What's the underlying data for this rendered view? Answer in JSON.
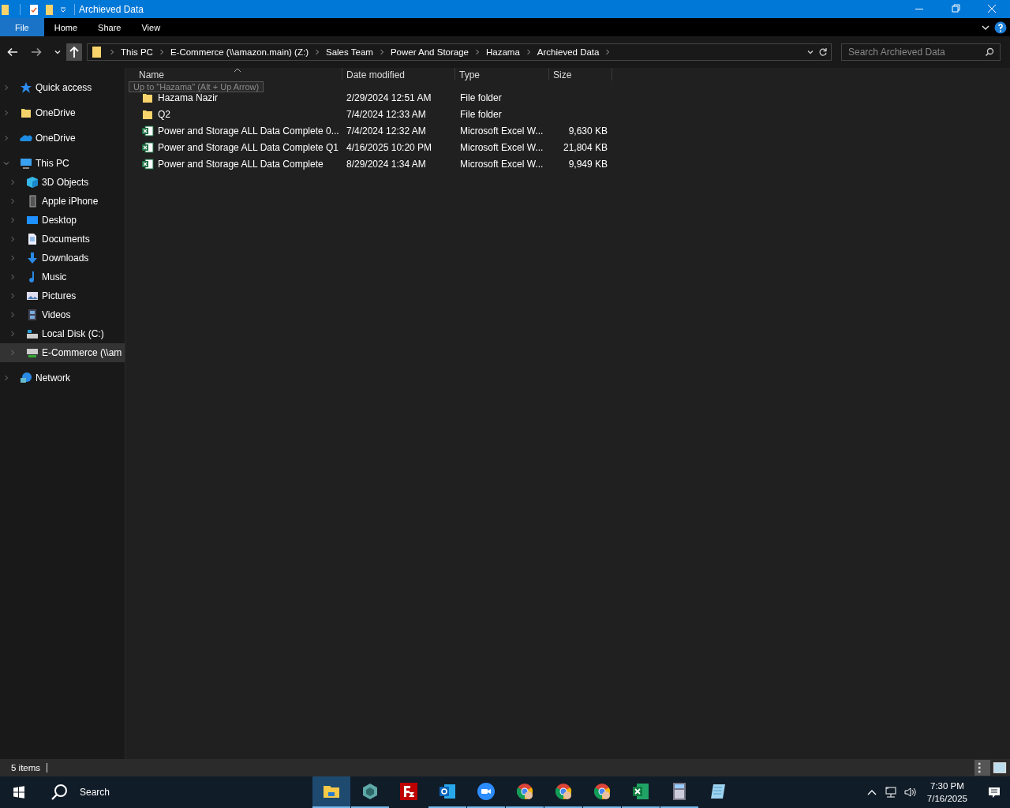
{
  "window": {
    "title": "Archieved Data"
  },
  "ribbon_tabs": [
    {
      "label": "File",
      "selected": true
    },
    {
      "label": "Home",
      "selected": false
    },
    {
      "label": "Share",
      "selected": false
    },
    {
      "label": "View",
      "selected": false
    }
  ],
  "address_bar": {
    "segments": [
      "This PC",
      "E-Commerce (\\\\amazon.main) (Z:)",
      "Sales Team",
      "Power And Storage",
      "Hazama",
      "Archieved Data"
    ]
  },
  "search": {
    "placeholder": "Search Archieved Data"
  },
  "tooltip": "Up to \"Hazama\" (Alt + Up Arrow)",
  "sidebar": {
    "items": [
      {
        "label": "Quick access",
        "kind": "star",
        "expanded": false,
        "selected": false
      },
      {
        "label": "OneDrive",
        "kind": "folder",
        "expanded": false,
        "selected": false
      },
      {
        "label": "OneDrive",
        "kind": "cloud",
        "expanded": false,
        "selected": false
      },
      {
        "label": "This PC",
        "kind": "pc",
        "expanded": true,
        "selected": false,
        "children": [
          {
            "label": "3D Objects",
            "kind": "cube",
            "expanded": false,
            "selected": false
          },
          {
            "label": "Apple iPhone",
            "kind": "phone",
            "expanded": false,
            "selected": false
          },
          {
            "label": "Desktop",
            "kind": "desktop",
            "expanded": false,
            "selected": false
          },
          {
            "label": "Documents",
            "kind": "document",
            "expanded": false,
            "selected": false
          },
          {
            "label": "Downloads",
            "kind": "download",
            "expanded": false,
            "selected": false
          },
          {
            "label": "Music",
            "kind": "music",
            "expanded": false,
            "selected": false
          },
          {
            "label": "Pictures",
            "kind": "pictures",
            "expanded": false,
            "selected": false
          },
          {
            "label": "Videos",
            "kind": "videos",
            "expanded": false,
            "selected": false
          },
          {
            "label": "Local Disk (C:)",
            "kind": "disk",
            "expanded": false,
            "selected": false
          },
          {
            "label": "E-Commerce (\\\\am",
            "kind": "netdrive",
            "expanded": false,
            "selected": true
          }
        ]
      },
      {
        "label": "Network",
        "kind": "network",
        "expanded": false,
        "selected": false
      }
    ]
  },
  "table": {
    "columns": [
      "Name",
      "Date modified",
      "Type",
      "Size"
    ],
    "rows": [
      {
        "kind": "folder",
        "name": "Hazama Nazir",
        "date": "2/29/2024 12:51 AM",
        "type": "File folder"
      },
      {
        "kind": "folder",
        "name": "Q2",
        "date": "7/4/2024 12:33 AM",
        "type": "File folder"
      },
      {
        "kind": "excel",
        "name": "Power and Storage ALL Data Complete 0...",
        "date": "7/4/2024 12:32 AM",
        "type": "Microsoft Excel W...",
        "size": "9,630 KB"
      },
      {
        "kind": "excel",
        "name": "Power and Storage ALL Data Complete Q1",
        "date": "4/16/2025 10:20 PM",
        "type": "Microsoft Excel W...",
        "size": "21,804 KB"
      },
      {
        "kind": "excel",
        "name": "Power and Storage ALL Data Complete",
        "date": "8/29/2024 1:34 AM",
        "type": "Microsoft Excel W...",
        "size": "9,949 KB"
      }
    ]
  },
  "status_bar": {
    "count": "5 items"
  },
  "taskbar": {
    "search": "Search",
    "apps": [
      {
        "kind": "explorer",
        "running": true,
        "selected": true
      },
      {
        "kind": "hexagon",
        "running": true,
        "selected": false
      },
      {
        "kind": "filezilla",
        "running": false,
        "selected": false
      },
      {
        "kind": "outlook",
        "running": true,
        "selected": false
      },
      {
        "kind": "zoom",
        "running": true,
        "selected": false
      },
      {
        "kind": "chrome",
        "running": true,
        "selected": false
      },
      {
        "kind": "chrome",
        "running": true,
        "selected": false
      },
      {
        "kind": "chrome",
        "running": true,
        "selected": false
      },
      {
        "kind": "excel",
        "running": true,
        "selected": false
      },
      {
        "kind": "calculator",
        "running": true,
        "selected": false
      },
      {
        "kind": "notepad",
        "running": false,
        "selected": false
      }
    ],
    "time": "7:30 PM",
    "date": "7/16/2025"
  }
}
